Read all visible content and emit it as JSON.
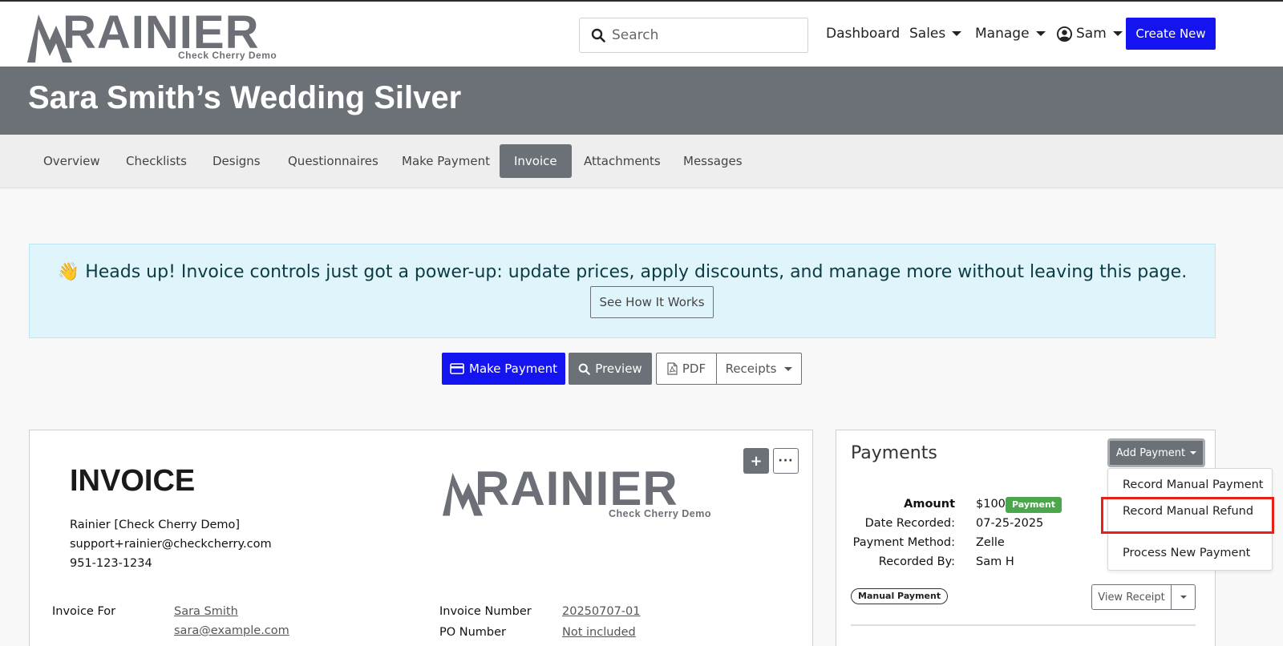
{
  "header": {
    "logo_text": "RAINIER",
    "logo_sub": "Check Cherry Demo",
    "search_placeholder": "Search",
    "nav": {
      "dashboard": "Dashboard",
      "sales": "Sales",
      "manage": "Manage",
      "user": "Sam"
    },
    "create_new": "Create New"
  },
  "page": {
    "title": "Sara Smith’s Wedding Silver"
  },
  "tabs": [
    {
      "label": "Overview"
    },
    {
      "label": "Checklists"
    },
    {
      "label": "Designs"
    },
    {
      "label": "Questionnaires"
    },
    {
      "label": "Make Payment"
    },
    {
      "label": "Invoice",
      "active": true
    },
    {
      "label": "Attachments"
    },
    {
      "label": "Messages"
    }
  ],
  "alert": {
    "emoji": "👋",
    "text": "Heads up! Invoice controls just got a power-up: update prices, apply discounts, and manage more without leaving this page.",
    "button": "See How It Works"
  },
  "actions": {
    "make_payment": "Make Payment",
    "preview": "Preview",
    "pdf": "PDF",
    "receipts": "Receipts"
  },
  "invoice": {
    "heading": "INVOICE",
    "company_name": "Rainier [Check Cherry Demo]",
    "company_email": "support+rainier@checkcherry.com",
    "company_phone": "951-123-1234",
    "for_label": "Invoice For",
    "client_name": "Sara Smith",
    "client_email": "sara@example.com",
    "number_label": "Invoice Number",
    "number_value": "20250707-01",
    "po_label": "PO Number",
    "po_value": "Not included"
  },
  "payments": {
    "title": "Payments",
    "add_payment": "Add Payment",
    "amount_label": "Amount",
    "amount_value": "$100",
    "amount_badge": "Payment",
    "date_label": "Date Recorded:",
    "date_value": "07-25-2025",
    "method_label": "Payment Method:",
    "method_value": "Zelle",
    "by_label": "Recorded By:",
    "by_value": "Sam H",
    "type_badge": "Manual Payment",
    "view_receipt": "View Receipt"
  },
  "dropdown": {
    "items": [
      {
        "label": "Record Manual Payment"
      },
      {
        "label": "Record Manual Refund"
      },
      {
        "label": "Process New Payment"
      }
    ]
  },
  "colors": {
    "primary": "#1414f0",
    "secondary": "#6c7177",
    "success": "#4ca64c",
    "highlight": "#e8201a",
    "alert_bg": "#e0f5fb"
  }
}
